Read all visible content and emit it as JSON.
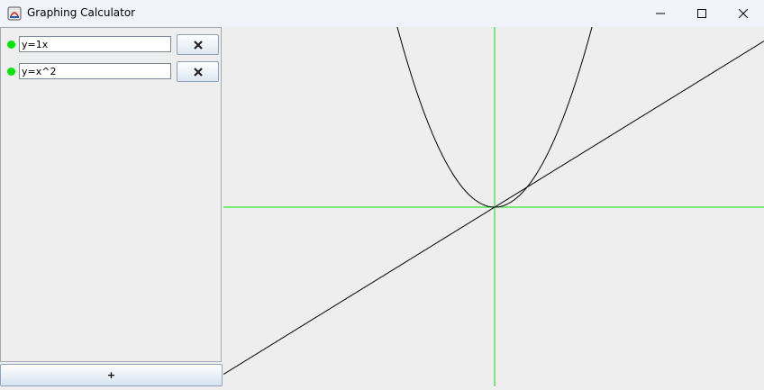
{
  "window": {
    "title": "Graphing Calculator",
    "icon": "java-app-icon",
    "controls": [
      "minimize-icon",
      "maximize-icon",
      "close-icon"
    ]
  },
  "sidebar": {
    "equations": [
      {
        "value": "y=1x",
        "color": "#00e600",
        "remove_icon": "close-x-icon"
      },
      {
        "value": "y=x^2",
        "color": "#00e600",
        "remove_icon": "close-x-icon"
      }
    ],
    "add_label": "+"
  },
  "plot": {
    "axes_color": "#00e600",
    "curve_color": "#000000",
    "functions": [
      "1x",
      "x^2"
    ],
    "grid": false
  }
}
